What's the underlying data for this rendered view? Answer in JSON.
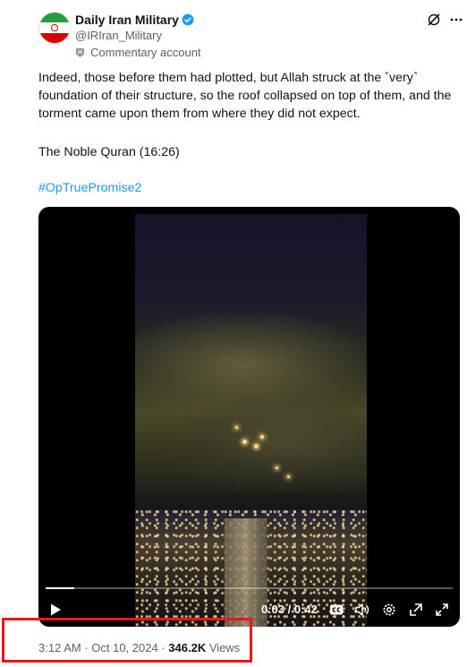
{
  "account": {
    "display_name": "Daily Iran Military",
    "handle": "@IRIran_Military",
    "label": "Commentary account"
  },
  "post": {
    "text": "Indeed, those before them had plotted, but Allah struck at the ˹very˺ foundation of their structure, so the roof collapsed on top of them, and the torment came upon them from where they did not expect.",
    "source": "The Noble Quran (16:26)",
    "hashtag": "#OpTruePromise2"
  },
  "video": {
    "current_time": "0:03",
    "separator": " / ",
    "duration": "0:42",
    "progress_fraction": 0.07
  },
  "meta": {
    "time": "3:12 AM",
    "dot1": " · ",
    "date": "Oct 10, 2024",
    "dot2": " · ",
    "views_count": "346.2K",
    "views_label": " Views"
  },
  "colors": {
    "accent": "#1d9bf0",
    "secondary_text": "#536471",
    "highlight_box": "#e8171e"
  },
  "icons": [
    "verified-badge-icon",
    "grok-icon",
    "more-icon",
    "commentary-account-icon",
    "play-icon",
    "captions-icon",
    "volume-icon",
    "settings-icon",
    "pop-out-icon",
    "fullscreen-icon"
  ]
}
